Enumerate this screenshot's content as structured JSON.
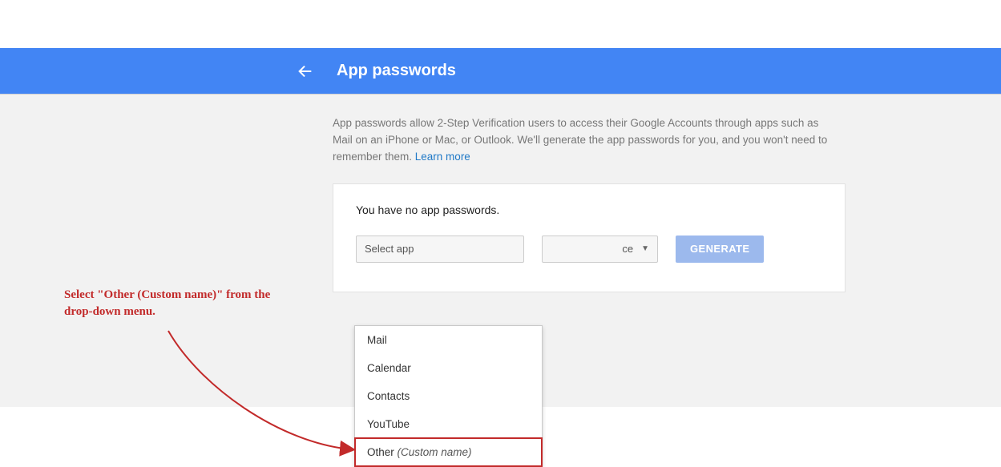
{
  "header": {
    "title": "App passwords"
  },
  "description": {
    "text": "App passwords allow 2-Step Verification users to access their Google Accounts through apps such as Mail on an iPhone or Mac, or Outlook. We'll generate the app passwords for you, and you won't need to remember them. ",
    "learn_more": "Learn more"
  },
  "card": {
    "empty_msg": "You have no app passwords.",
    "select_app_label": "Select app",
    "select_device_label": "ce",
    "generate_label": "GENERATE"
  },
  "dropdown": {
    "items": [
      {
        "label": "Mail",
        "italic": ""
      },
      {
        "label": "Calendar",
        "italic": ""
      },
      {
        "label": "Contacts",
        "italic": ""
      },
      {
        "label": "YouTube",
        "italic": ""
      },
      {
        "label": "Other ",
        "italic": "(Custom name)"
      }
    ]
  },
  "annotation": {
    "text": "Select \"Other (Custom name)\" from the drop-down menu."
  }
}
